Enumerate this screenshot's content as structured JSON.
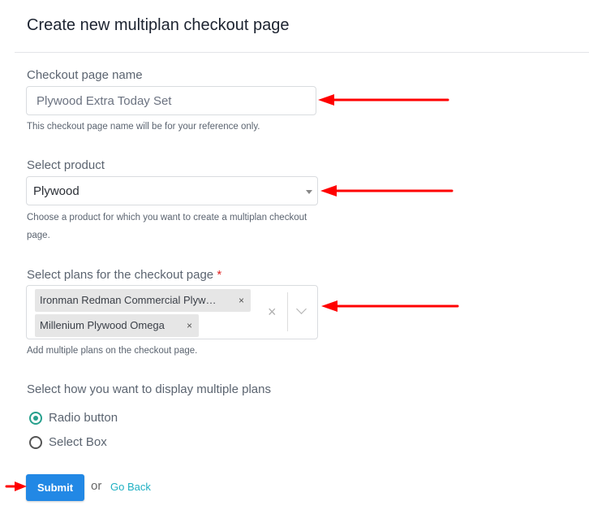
{
  "page": {
    "title": "Create new multiplan checkout page"
  },
  "form": {
    "name_field": {
      "label": "Checkout page name",
      "value": "Plywood Extra Today Set",
      "help": "This checkout page name will be for your reference only."
    },
    "product_field": {
      "label": "Select product",
      "value": "Plywood",
      "help": "Choose a product for which you want to create a multiplan checkout page."
    },
    "plans_field": {
      "label": "Select plans for the checkout page",
      "required_mark": "*",
      "selected": [
        "Ironman Redman Commercial Plyw…",
        "Millenium Plywood Omega"
      ],
      "chip_remove": "×",
      "clear_all": "×",
      "help": "Add multiple plans on the checkout page."
    },
    "display_field": {
      "label": "Select how you want to display multiple plans",
      "options": [
        {
          "label": "Radio button",
          "checked": true
        },
        {
          "label": "Select Box",
          "checked": false
        }
      ]
    },
    "actions": {
      "submit": "Submit",
      "or": "or",
      "go_back": "Go Back"
    }
  },
  "annotations": {
    "arrow_color": "#ff0000"
  },
  "colors": {
    "primary": "#2288e5",
    "accent": "#27a08d",
    "link": "#1fb0c3",
    "required": "#e02020"
  }
}
